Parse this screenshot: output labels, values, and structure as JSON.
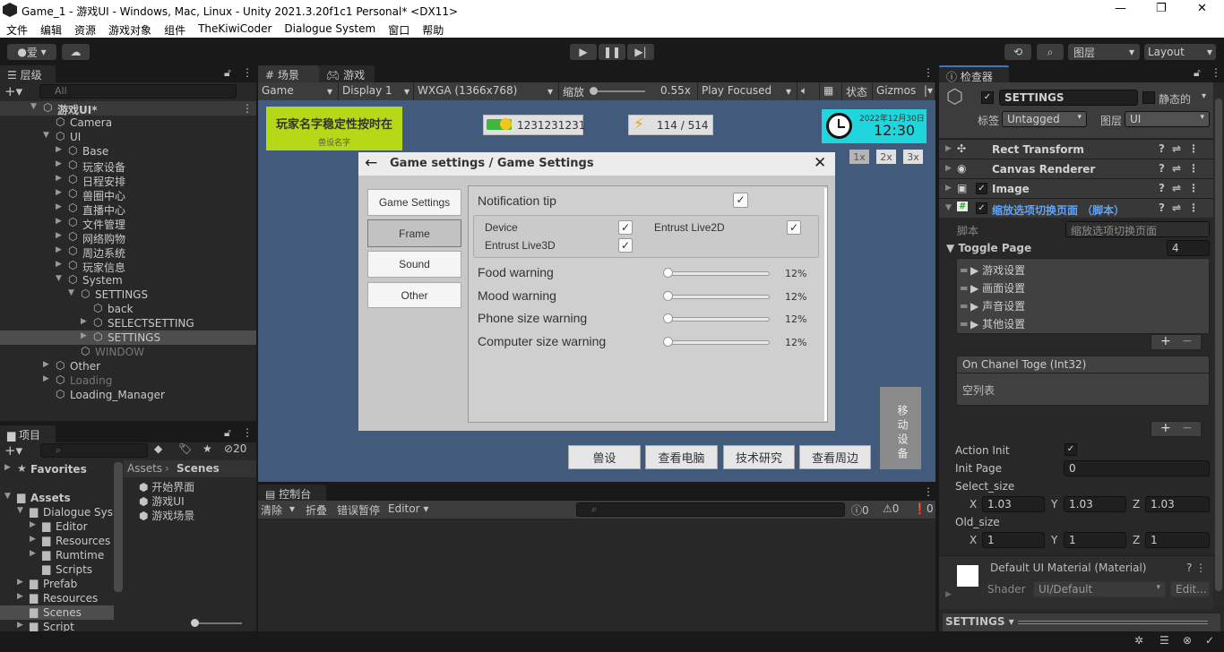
{
  "window": {
    "title": "Game_1 - 游戏UI - Windows, Mac, Linux - Unity 2021.3.20f1c1 Personal* <DX11>"
  },
  "menu": [
    "文件",
    "编辑",
    "资源",
    "游戏对象",
    "组件",
    "TheKiwiCoder",
    "Dialogue System",
    "窗口",
    "帮助"
  ],
  "toolbar": {
    "account": "爱",
    "layers": "图层",
    "layout": "Layout"
  },
  "hierarchy": {
    "tab": "层级",
    "search_placeholder": "All",
    "items": [
      {
        "label": "游戏UI*",
        "depth": 0,
        "arrow": "open",
        "bold": true
      },
      {
        "label": "Camera",
        "depth": 1
      },
      {
        "label": "UI",
        "depth": 1,
        "arrow": "open"
      },
      {
        "label": "Base",
        "depth": 2,
        "arrow": "closed"
      },
      {
        "label": "玩家设备",
        "depth": 2,
        "arrow": "closed"
      },
      {
        "label": "日程安排",
        "depth": 2,
        "arrow": "closed"
      },
      {
        "label": "兽圈中心",
        "depth": 2,
        "arrow": "closed"
      },
      {
        "label": "直播中心",
        "depth": 2,
        "arrow": "closed"
      },
      {
        "label": "文件管理",
        "depth": 2,
        "arrow": "closed"
      },
      {
        "label": "网络购物",
        "depth": 2,
        "arrow": "closed"
      },
      {
        "label": "周边系统",
        "depth": 2,
        "arrow": "closed"
      },
      {
        "label": "玩家信息",
        "depth": 2,
        "arrow": "closed"
      },
      {
        "label": "System",
        "depth": 2,
        "arrow": "open"
      },
      {
        "label": "SETTINGS",
        "depth": 3,
        "arrow": "open"
      },
      {
        "label": "back",
        "depth": 4
      },
      {
        "label": "SELECTSETTING",
        "depth": 4,
        "arrow": "closed"
      },
      {
        "label": "SETTINGS",
        "depth": 4,
        "arrow": "closed",
        "selected": true
      },
      {
        "label": "WINDOW",
        "depth": 3,
        "dim": true
      },
      {
        "label": "Other",
        "depth": 1,
        "arrow": "closed"
      },
      {
        "label": "Loading",
        "depth": 1,
        "arrow": "closed",
        "dim": true
      },
      {
        "label": "Loading_Manager",
        "depth": 1
      }
    ]
  },
  "project": {
    "tab": "项目",
    "hidden_count": "20",
    "tree": [
      {
        "label": "Favorites",
        "depth": 0,
        "arrow": "closed",
        "bold": true,
        "icon": "star"
      },
      {
        "label": "",
        "depth": 0
      },
      {
        "label": "Assets",
        "depth": 0,
        "arrow": "open",
        "bold": true,
        "icon": "folder-open"
      },
      {
        "label": "Dialogue Sys",
        "depth": 1,
        "arrow": "open",
        "icon": "folder-open"
      },
      {
        "label": "Editor",
        "depth": 2,
        "arrow": "closed",
        "icon": "folder"
      },
      {
        "label": "Resources",
        "depth": 2,
        "arrow": "closed",
        "icon": "folder"
      },
      {
        "label": "Rumtime",
        "depth": 2,
        "arrow": "closed",
        "icon": "folder"
      },
      {
        "label": "Scripts",
        "depth": 2,
        "icon": "folder"
      },
      {
        "label": "Prefab",
        "depth": 1,
        "arrow": "closed",
        "icon": "folder"
      },
      {
        "label": "Resources",
        "depth": 1,
        "arrow": "closed",
        "icon": "folder"
      },
      {
        "label": "Scenes",
        "depth": 1,
        "icon": "folder",
        "selected": true
      },
      {
        "label": "Script",
        "depth": 1,
        "arrow": "closed",
        "icon": "folder"
      }
    ],
    "breadcrumb": [
      "Assets",
      "Scenes"
    ],
    "files": [
      "开始界面",
      "游戏UI",
      "游戏场景"
    ]
  },
  "game": {
    "tabs": [
      "场景",
      "游戏"
    ],
    "bar": {
      "mode": "Game",
      "display": "Display 1",
      "resolution": "WXGA (1366x768)",
      "scale_label": "缩放",
      "scale": "0.55x",
      "play": "Play Focused",
      "stats": "状态",
      "gizmos": "Gizmos"
    },
    "hud": {
      "player_name": "玩家名字稳定性按时在",
      "name_sub": "兽设名字",
      "money": "1231231231",
      "energy": "114 / 514",
      "date": "2022年12月30日",
      "time": "12:30",
      "zoom_buttons": [
        "1x",
        "2x",
        "3x"
      ]
    },
    "dialog": {
      "title": "Game settings / Game Settings",
      "tabs": [
        "Game Settings",
        "Frame",
        "Sound",
        "Other"
      ],
      "selected_tab": "Frame",
      "notification": {
        "label": "Notification tip",
        "checked": true
      },
      "toggles": [
        {
          "label": "Device",
          "checked": true
        },
        {
          "label": "Entrust Live2D",
          "checked": true
        },
        {
          "label": "Entrust Live3D",
          "checked": true
        }
      ],
      "sliders": [
        {
          "label": "Food warning",
          "value": "12%"
        },
        {
          "label": "Mood warning",
          "value": "12%"
        },
        {
          "label": "Phone size warning",
          "value": "12%"
        },
        {
          "label": "Computer size warning",
          "value": "12%"
        }
      ]
    },
    "side_button": "移动设备",
    "bottom_buttons": [
      "兽设",
      "查看电脑",
      "技术研究",
      "查看周边"
    ]
  },
  "console": {
    "tab": "控制台",
    "clear": "清除",
    "collapse": "折叠",
    "error_pause": "错误暂停",
    "editor": "Editor",
    "counts": [
      "0",
      "0",
      "0"
    ]
  },
  "inspector": {
    "tab": "检查器",
    "object_name": "SETTINGS",
    "static_label": "静态的",
    "tag_label": "标签",
    "tag": "Untagged",
    "layer_label": "图层",
    "layer": "UI",
    "components": [
      "Rect Transform",
      "Canvas Renderer",
      "Image",
      "缩放选项切换页面 （脚本）"
    ],
    "script_label": "脚本",
    "script_value": "缩放选项切换页面",
    "toggle_page": {
      "label": "Toggle Page",
      "count": "4",
      "items": [
        "游戏设置",
        "画面设置",
        "声音设置",
        "其他设置"
      ]
    },
    "event": {
      "label": "On Chanel Toge (Int32)",
      "empty": "空列表"
    },
    "action_init": "Action Init",
    "init_page_label": "Init Page",
    "init_page": "0",
    "select_size": {
      "label": "Select_size",
      "x": "1.03",
      "y": "1.03",
      "z": "1.03"
    },
    "old_size": {
      "label": "Old_size",
      "x": "1",
      "y": "1",
      "z": "1"
    },
    "material": {
      "name": "Default UI Material (Material)",
      "shader_label": "Shader",
      "shader": "UI/Default",
      "edit": "Edit..."
    },
    "footer": "SETTINGS"
  },
  "colors": {
    "game_bg": "#425a7c",
    "name_box": "#b5d916",
    "clock_box": "#1ed6dc",
    "script_title": "#5ea4f6"
  }
}
